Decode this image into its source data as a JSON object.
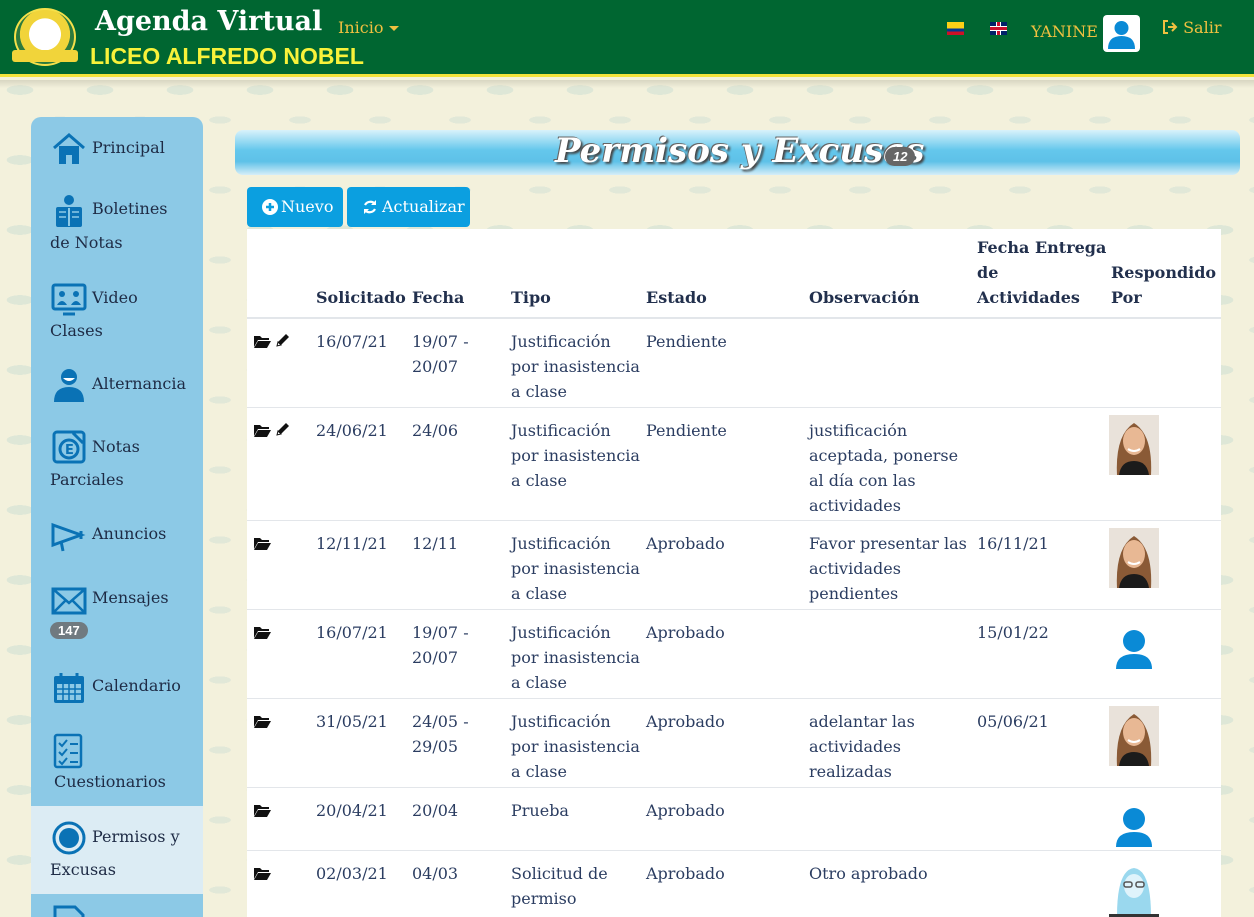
{
  "header": {
    "app_title": "Agenda Virtual",
    "school_name": "LICEO ALFREDO NOBEL",
    "nav_inicio": "Inicio",
    "user_name": "YANINE",
    "logout_label": "Salir"
  },
  "sidebar": {
    "items": [
      {
        "label": "Principal",
        "icon": "home-icon"
      },
      {
        "label": "Boletines",
        "label2": "de Notas",
        "icon": "report-card-icon"
      },
      {
        "label": "Video",
        "label2": "Clases",
        "icon": "video-class-icon"
      },
      {
        "label": "Alternancia",
        "icon": "masked-person-icon"
      },
      {
        "label": "Notas",
        "label2": "Parciales",
        "icon": "grade-icon"
      },
      {
        "label": "Anuncios",
        "icon": "megaphone-icon"
      },
      {
        "label": "Mensajes",
        "icon": "envelope-icon",
        "badge": "147"
      },
      {
        "label": "Calendario",
        "icon": "calendar-icon"
      },
      {
        "label": "Cuestionarios",
        "icon": "checklist-icon"
      },
      {
        "label": "Permisos y",
        "label2": "Excusas",
        "icon": "radio-circle-icon",
        "active": true
      }
    ]
  },
  "page": {
    "title": "Permisos y Excusas",
    "count": "12",
    "btn_nuevo": "Nuevo",
    "btn_actualizar": "Actualizar"
  },
  "table": {
    "headers": {
      "solicitado": "Solicitado",
      "fecha": "Fecha",
      "tipo": "Tipo",
      "estado": "Estado",
      "observacion": "Observación",
      "fecha_entrega_1": "Fecha Entrega",
      "fecha_entrega_2": "de",
      "fecha_entrega_3": "Actividades",
      "respondido_1": "Respondido",
      "respondido_2": "Por"
    },
    "rows": [
      {
        "solicitado": "16/07/21",
        "fecha1": "19/07 -",
        "fecha2": "20/07",
        "tipo1": "Justificación",
        "tipo2": "por inasistencia",
        "tipo3": "a clase",
        "estado": "Pendiente",
        "obs1": "",
        "obs2": "",
        "obs3": "",
        "obs4": "",
        "entrega": "",
        "responder": "none",
        "editable": true
      },
      {
        "solicitado": "24/06/21",
        "fecha1": "24/06",
        "fecha2": "",
        "tipo1": "Justificación",
        "tipo2": "por inasistencia",
        "tipo3": "a clase",
        "estado": "Pendiente",
        "obs1": "justificación",
        "obs2": "aceptada, ponerse",
        "obs3": "al día con las",
        "obs4": "actividades",
        "entrega": "",
        "responder": "photo",
        "editable": true
      },
      {
        "solicitado": "12/11/21",
        "fecha1": "12/11",
        "fecha2": "",
        "tipo1": "Justificación",
        "tipo2": "por inasistencia",
        "tipo3": "a clase",
        "estado": "Aprobado",
        "obs1": "Favor presentar las",
        "obs2": "actividades",
        "obs3": "pendientes",
        "obs4": "",
        "entrega": "16/11/21",
        "responder": "photo",
        "editable": false
      },
      {
        "solicitado": "16/07/21",
        "fecha1": "19/07 -",
        "fecha2": "20/07",
        "tipo1": "Justificación",
        "tipo2": "por inasistencia",
        "tipo3": "a clase",
        "estado": "Aprobado",
        "obs1": "",
        "obs2": "",
        "obs3": "",
        "obs4": "",
        "entrega": "15/01/22",
        "responder": "generic",
        "editable": false
      },
      {
        "solicitado": "31/05/21",
        "fecha1": "24/05 -",
        "fecha2": "29/05",
        "tipo1": "Justificación",
        "tipo2": "por inasistencia",
        "tipo3": "a clase",
        "estado": "Aprobado",
        "obs1": "adelantar las",
        "obs2": "actividades",
        "obs3": "realizadas",
        "obs4": "",
        "entrega": "05/06/21",
        "responder": "photo",
        "editable": false
      },
      {
        "solicitado": "20/04/21",
        "fecha1": "20/04",
        "fecha2": "",
        "tipo1": "Prueba",
        "tipo2": "",
        "tipo3": "",
        "estado": "Aprobado",
        "obs1": "",
        "obs2": "",
        "obs3": "",
        "obs4": "",
        "entrega": "",
        "responder": "generic",
        "editable": false
      },
      {
        "solicitado": "02/03/21",
        "fecha1": "04/03",
        "fecha2": "",
        "tipo1": "Solicitud de",
        "tipo2": "permiso",
        "tipo3": "",
        "estado": "Aprobado",
        "obs1": "Otro aprobado",
        "obs2": "",
        "obs3": "",
        "obs4": "",
        "entrega": "",
        "responder": "avatar-glasses",
        "editable": false
      }
    ]
  },
  "colors": {
    "header_green": "#006631",
    "accent_yellow": "#f3e33c",
    "sidebar_blue": "#8cc9e6",
    "button_blue": "#0b9fe0"
  }
}
